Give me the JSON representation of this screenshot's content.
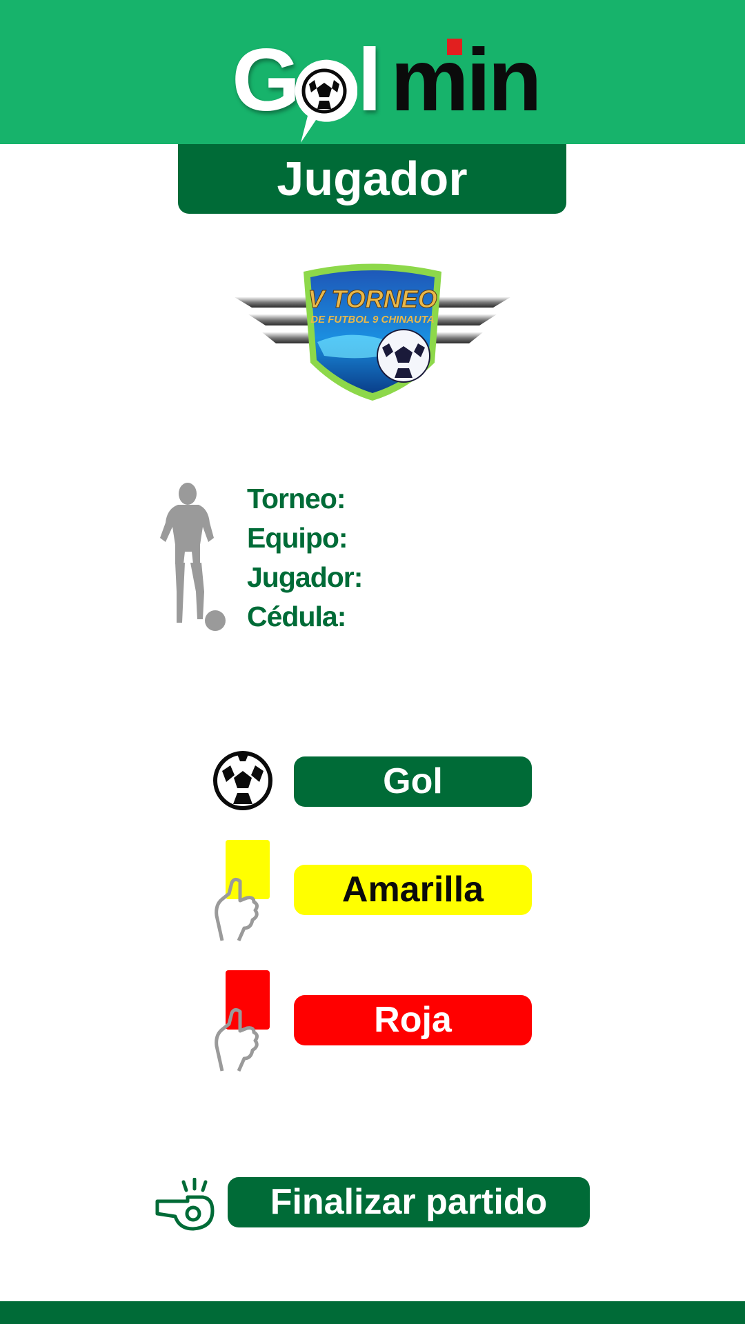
{
  "app": {
    "logo_text": "Golmin",
    "colors": {
      "header_green": "#17b36b",
      "dark_green": "#006b37",
      "yellow": "#ffff00",
      "red": "#ff0000"
    }
  },
  "page_title": "Jugador",
  "tournament_badge": {
    "text_line1": "V TORNEO",
    "text_line2": "DE FUTBOL 9 CHINAUTA"
  },
  "player_info": {
    "torneo_label": "Torneo:",
    "equipo_label": "Equipo:",
    "jugador_label": "Jugador:",
    "cedula_label": "Cédula:"
  },
  "actions": {
    "gol_label": "Gol",
    "amarilla_label": "Amarilla",
    "roja_label": "Roja",
    "finalizar_label": "Finalizar partido"
  },
  "icons": [
    "soccer-ball-icon",
    "yellow-card-icon",
    "red-card-icon",
    "whistle-icon",
    "player-silhouette-icon"
  ]
}
